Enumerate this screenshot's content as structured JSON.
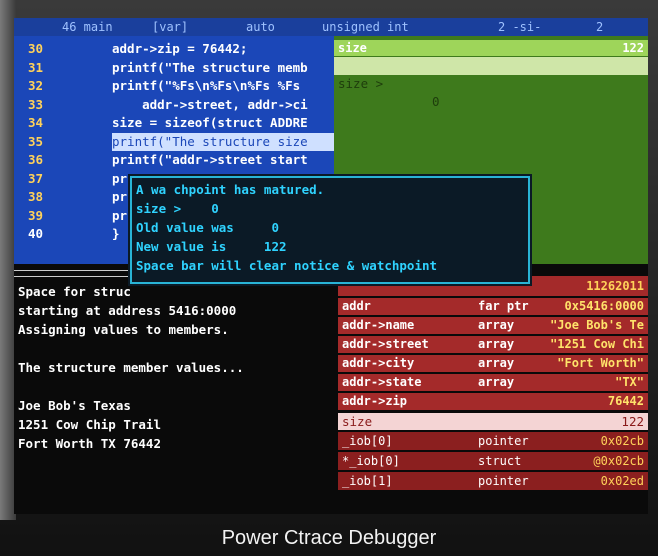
{
  "status_bar": {
    "line": "46 main",
    "mode": "[var]",
    "display": "auto",
    "type": "unsigned int",
    "format": "2 -si-",
    "value": "2"
  },
  "source": {
    "lines": [
      {
        "ln": "30",
        "code": "addr->zip = 76442;"
      },
      {
        "ln": "31",
        "code": "printf(\"The structure memb"
      },
      {
        "ln": "32",
        "code": "printf(\"%Fs\\n%Fs\\n%Fs %Fs"
      },
      {
        "ln": "33",
        "code": "    addr->street, addr->ci"
      },
      {
        "ln": "34",
        "code": "size = sizeof(struct ADDRE"
      },
      {
        "ln": "35",
        "code": "printf(\"The structure size"
      },
      {
        "ln": "36",
        "code": "printf(\"addr->street start"
      },
      {
        "ln": "37",
        "code": "pr"
      },
      {
        "ln": "38",
        "code": "pr"
      },
      {
        "ln": "39",
        "code": "pr"
      },
      {
        "ln": "40",
        "code": "}"
      }
    ]
  },
  "watch": {
    "header_name": "size",
    "header_value": "122",
    "row_name": "size >",
    "row_value": "0"
  },
  "popup": {
    "lines": [
      "A wa chpoint has matured.",
      "size >    0",
      "Old value was     0",
      "New value is     122",
      "Space bar will clear notice & watchpoint"
    ]
  },
  "output": {
    "lines": [
      "Space for struc",
      "starting at address 5416:0000",
      "Assigning values to members.",
      "",
      "The structure member values...",
      "",
      "Joe Bob's Texas",
      "1251 Cow Chip Trail",
      "Fort Worth TX 76442"
    ]
  },
  "memory": {
    "top_value": "11262011",
    "rows": [
      {
        "name": "addr",
        "type": "far ptr",
        "value": "0x5416:0000"
      },
      {
        "name": "addr->name",
        "type": "array",
        "value": "\"Joe Bob's Te"
      },
      {
        "name": "addr->street",
        "type": "array",
        "value": "\"1251 Cow Chi"
      },
      {
        "name": "addr->city",
        "type": "array",
        "value": "\"Fort Worth\""
      },
      {
        "name": "addr->state",
        "type": "array",
        "value": "\"TX\""
      },
      {
        "name": "addr->zip",
        "type": "",
        "value": "76442"
      }
    ],
    "size_row": {
      "name": "size",
      "value": "122"
    },
    "iob_rows": [
      {
        "name": "_iob[0]",
        "type": "pointer",
        "value": "0x02cb"
      },
      {
        "name": "*_iob[0]",
        "type": "struct",
        "value": "@0x02cb"
      },
      {
        "name": "_iob[1]",
        "type": "pointer",
        "value": "0x02ed"
      }
    ]
  },
  "caption": "Power Ctrace Debugger"
}
